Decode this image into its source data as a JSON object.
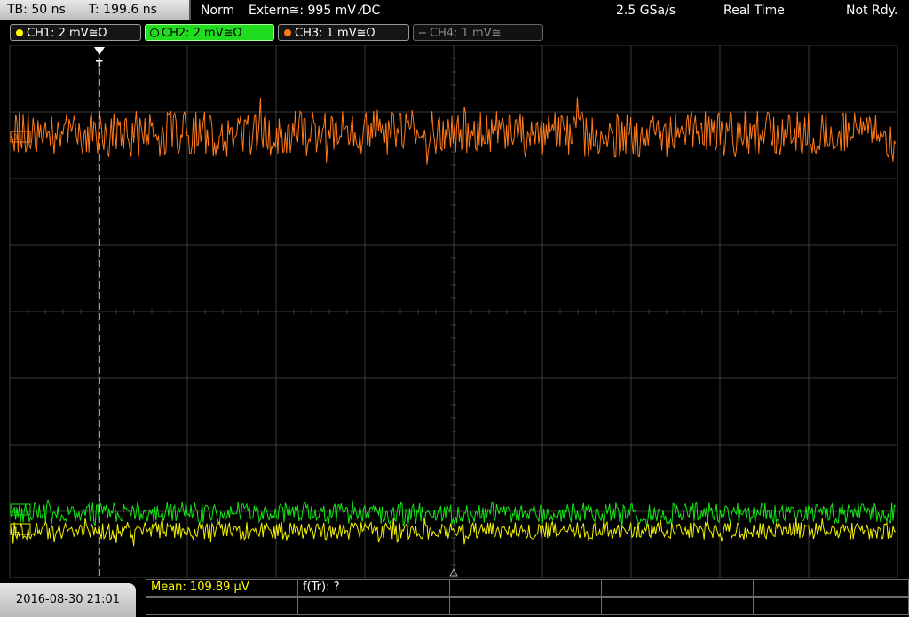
{
  "status": {
    "timebase": "TB: 50 ns",
    "trigger_time": "T: 199.6 ns",
    "mode": "Norm",
    "trigger_source": "Extern≅: 995 mV ⁄DC",
    "sample_rate": "2.5 GSa/s",
    "acq_mode": "Real Time",
    "state": "Not Rdy."
  },
  "channels": [
    {
      "label": "CH1: 2 mV≅Ω",
      "color": "#ffff00",
      "state": "on"
    },
    {
      "label": "CH2: 2 mV≅Ω",
      "color": "#00ff00",
      "state": "selected"
    },
    {
      "label": "CH3: 1 mV≅Ω",
      "color": "#ff7a1a",
      "state": "on"
    },
    {
      "label": "CH4: 1 mV≅",
      "color": "#808080",
      "state": "off"
    }
  ],
  "trigger_marker": "T",
  "date": "2016-08-30 21:01",
  "measurements": {
    "mean": "Mean: 109.89 µV",
    "freq": "f(Tr): ?"
  },
  "colors": {
    "grid": "#3a3a3a",
    "ch1": "#ffff00",
    "ch2": "#00ff00",
    "ch3": "#ff7a1a"
  }
}
